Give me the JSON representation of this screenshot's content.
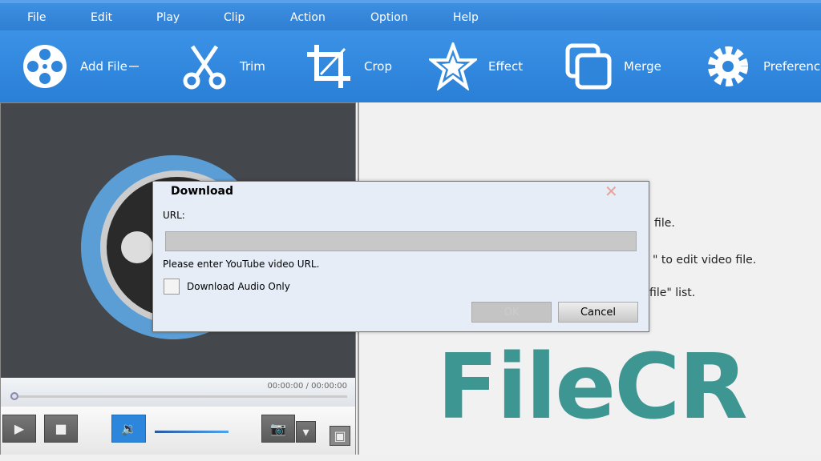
{
  "menu": [
    "File",
    "Edit",
    "Play",
    "Clip",
    "Action",
    "Option",
    "Help"
  ],
  "toolbar": [
    {
      "label": "Add File",
      "icon": "film-reel-icon"
    },
    {
      "label": "Trim",
      "icon": "scissors-icon"
    },
    {
      "label": "Crop",
      "icon": "crop-icon"
    },
    {
      "label": "Effect",
      "icon": "star-icon"
    },
    {
      "label": "Merge",
      "icon": "merge-icon"
    },
    {
      "label": "Preference",
      "icon": "gear-icon"
    }
  ],
  "player": {
    "time": "00:00:00 / 00:00:00",
    "volume_fraction": 0.85
  },
  "right_panel": {
    "line1": "file.",
    "line2": "\" to edit video file.",
    "line3": "file\" list."
  },
  "dialog": {
    "title": "Download",
    "url_label": "URL:",
    "url_value": "",
    "hint": "Please enter YouTube video URL.",
    "audio_only_label": "Download Audio Only",
    "audio_only_checked": false,
    "ok": "OK",
    "cancel": "Cancel"
  },
  "watermark": "FileCR",
  "colors": {
    "toolbar": "#2f85da",
    "watermark": "#3e9693"
  }
}
